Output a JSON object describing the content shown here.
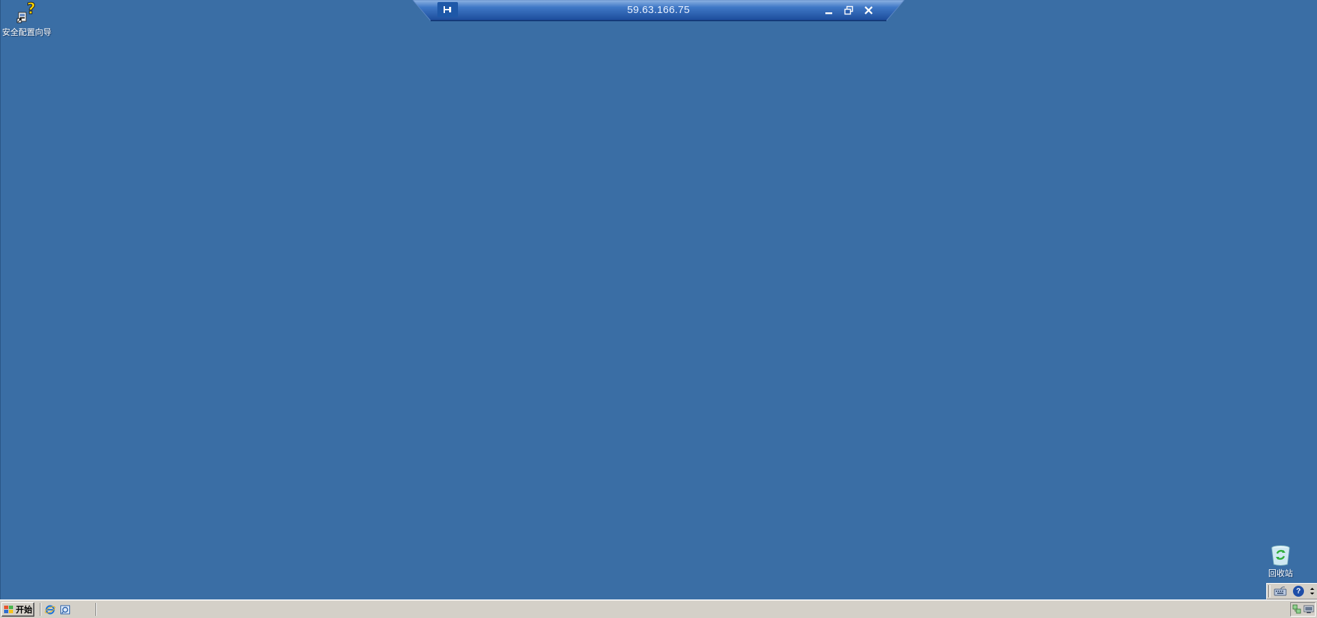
{
  "desktop": {
    "background_color": "#3a6ea5",
    "icons": [
      {
        "label": "安全配置向导",
        "icon": "security-config-wizard-icon"
      },
      {
        "label": "回收站",
        "icon": "recycle-bin-icon"
      }
    ]
  },
  "rdp_bar": {
    "title": "59.63.166.75",
    "pin_icon": "pin-icon",
    "minimize_icon": "minimize-icon",
    "restore_icon": "restore-icon",
    "close_icon": "close-icon"
  },
  "taskbar": {
    "start_label": "开始",
    "quick_launch": [
      {
        "icon": "internet-explorer-icon"
      },
      {
        "icon": "windows-explorer-icon"
      }
    ],
    "language_bar": {
      "keyboard_icon": "keyboard-icon",
      "help_label": "?",
      "options_icon": "options-icon"
    },
    "tray_icons": [
      {
        "icon": "network-icon"
      },
      {
        "icon": "network-connection-icon"
      }
    ]
  }
}
